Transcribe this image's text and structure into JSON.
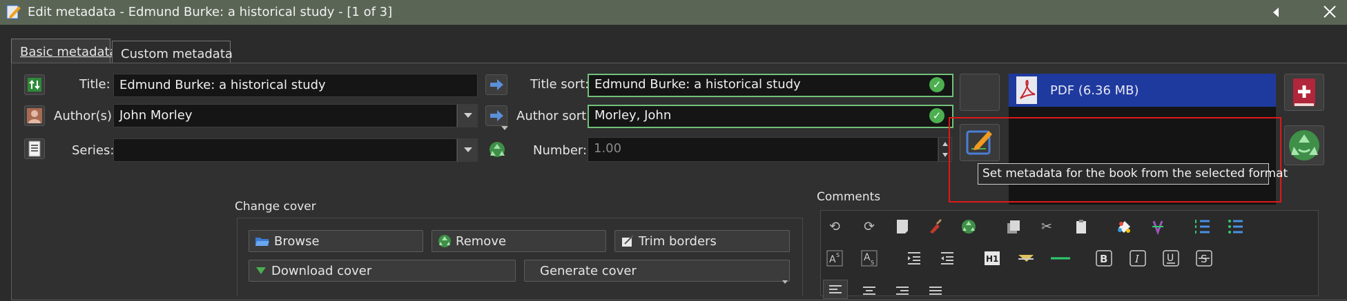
{
  "window": {
    "title": "Edit metadata - Edmund Burke: a historical study - [1 of 3]"
  },
  "tabs": [
    {
      "label": "Basic metadata",
      "active": true
    },
    {
      "label": "Custom metadata",
      "active": false
    }
  ],
  "form": {
    "title_label": "Title:",
    "title_value": "Edmund Burke: a historical study",
    "title_sort_label": "Title sort:",
    "title_sort_value": "Edmund Burke: a historical study",
    "author_label": "Author(s):",
    "author_value": "John Morley",
    "author_sort_label": "Author sort:",
    "author_sort_value": "Morley, John",
    "series_label": "Series:",
    "series_value": "",
    "number_label": "Number:",
    "number_value": "1.00"
  },
  "formats": {
    "items": [
      {
        "label": "PDF (6.36 MB)",
        "selected": true
      }
    ],
    "tooltip": "Set metadata for the book from the selected format"
  },
  "cover": {
    "heading": "Change cover",
    "browse": "Browse",
    "remove": "Remove",
    "trim": "Trim borders",
    "download": "Download cover",
    "generate": "Generate cover"
  },
  "comments": {
    "heading": "Comments"
  },
  "colors": {
    "titlebar": "#5a6556",
    "selection": "#1e3a9e",
    "ok_border": "#72c27a",
    "highlight_box": "#e01818"
  }
}
